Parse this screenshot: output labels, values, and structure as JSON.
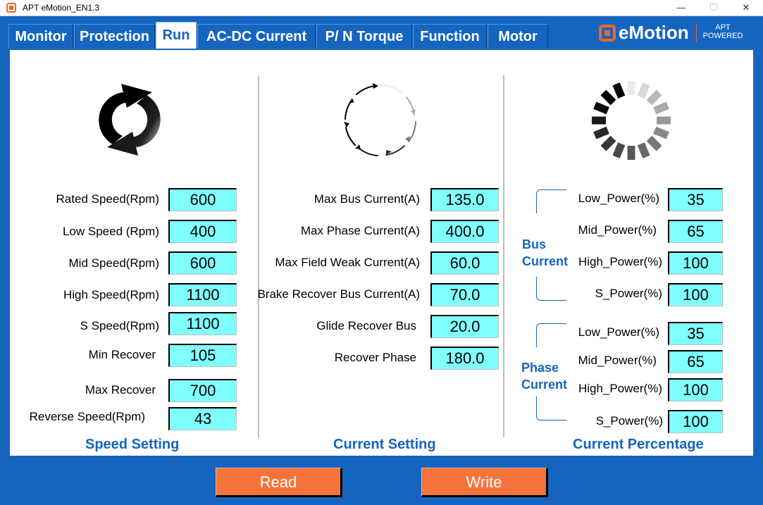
{
  "window": {
    "title": "APT eMotion_EN1.3",
    "minimize": "—",
    "maximize": "☐",
    "close": "✕"
  },
  "brand": {
    "name": "eMotion",
    "apt": "APT",
    "powered": "POWERED",
    "accent": "#f26522"
  },
  "tabs": [
    {
      "label": "Monitor"
    },
    {
      "label": "Protection"
    },
    {
      "label": "Run",
      "active": true
    },
    {
      "label": "AC-DC Current"
    },
    {
      "label": "P/ N Torque"
    },
    {
      "label": "Function"
    },
    {
      "label": "Motor"
    }
  ],
  "speed": {
    "title": "Speed Setting",
    "icon": "refresh-arrows-icon",
    "fields": [
      {
        "label": "Rated Speed(Rpm)",
        "value": "600"
      },
      {
        "label": "Low Speed (Rpm)",
        "value": "400"
      },
      {
        "label": "Mid Speed(Rpm)",
        "value": "600"
      },
      {
        "label": "High Speed(Rpm)",
        "value": "1100"
      },
      {
        "label": "S Speed(Rpm)",
        "value": "1100"
      },
      {
        "label": "Min Recover",
        "value": "105"
      },
      {
        "label": "Max Recover",
        "value": "700"
      },
      {
        "label": "Reverse Speed(Rpm)",
        "value": "43"
      }
    ]
  },
  "current": {
    "title": "Current Setting",
    "icon": "circular-arrows-icon",
    "fields": [
      {
        "label": "Max Bus Current(A)",
        "value": "135.0"
      },
      {
        "label": "Max Phase Current(A)",
        "value": "400.0"
      },
      {
        "label": "Max Field Weak Current(A)",
        "value": "60.0"
      },
      {
        "label": "Brake Recover  Bus Current(A)",
        "value": "70.0"
      },
      {
        "label": "Glide Recover  Bus",
        "value": "20.0"
      },
      {
        "label": "Recover Phase",
        "value": "180.0"
      }
    ]
  },
  "percentage": {
    "title": "Current Percentage",
    "icon": "loading-spinner-icon",
    "bus_label_1": "Bus",
    "bus_label_2": "Current",
    "phase_label_1": "Phase",
    "phase_label_2": "Current",
    "bus": [
      {
        "label": "Low_Power(%)",
        "value": "35"
      },
      {
        "label": "Mid_Power(%)",
        "value": "65"
      },
      {
        "label": "High_Power(%)",
        "value": "100"
      },
      {
        "label": "S_Power(%)",
        "value": "100"
      }
    ],
    "phase": [
      {
        "label": "Low_Power(%)",
        "value": "35"
      },
      {
        "label": "Mid_Power(%)",
        "value": "65"
      },
      {
        "label": "High_Power(%)",
        "value": "100"
      },
      {
        "label": "S_Power(%)",
        "value": "100"
      }
    ]
  },
  "actions": {
    "read": "Read",
    "write": "Write"
  },
  "colors": {
    "tab_bg": "#1565c0",
    "field_bg": "#80ffff",
    "button_bg": "#f4743b",
    "section_title": "#1565c0"
  }
}
